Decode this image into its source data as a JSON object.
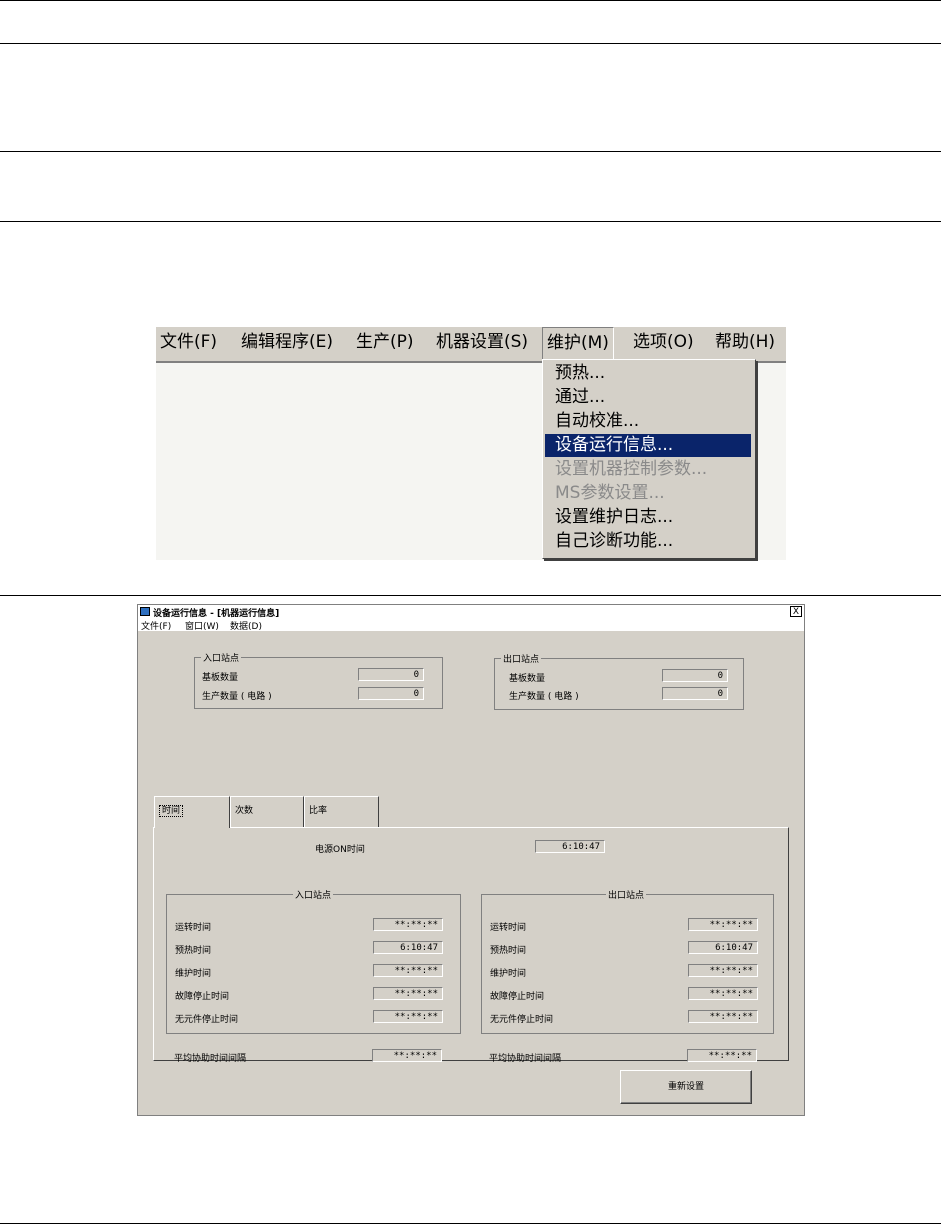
{
  "menu_screenshot": {
    "menubar": [
      {
        "label": "文件(F)"
      },
      {
        "label": "编辑程序(E)"
      },
      {
        "label": "生产(P)"
      },
      {
        "label": "机器设置(S)"
      },
      {
        "label": "维护(M)"
      },
      {
        "label": "选项(O)"
      },
      {
        "label": "帮助(H)"
      }
    ],
    "maintenance_dropdown": [
      {
        "label": "预热..."
      },
      {
        "label": "通过..."
      },
      {
        "label": "自动校准..."
      },
      {
        "label": "设备运行信息...",
        "state": "selected"
      },
      {
        "label": "设置机器控制参数...",
        "state": "disabled"
      },
      {
        "label": "MS参数设置...",
        "state": "disabled"
      },
      {
        "label": "设置维护日志..."
      },
      {
        "label": "自己诊断功能..."
      }
    ],
    "selection_color": "#0a246a"
  },
  "window": {
    "title": "设备运行信息 - [机器运行信息]",
    "close_label": "X",
    "menubar": [
      "文件(F)",
      "窗口(W)",
      "数据(D)"
    ],
    "entrance_station": {
      "legend": "入口站点",
      "board_count_label": "基板数量",
      "board_count_value": "0",
      "production_count_label": "生产数量 ( 电路 )",
      "production_count_value": "0"
    },
    "exit_station": {
      "legend": "出口站点",
      "board_count_label": "基板数量",
      "board_count_value": "0",
      "production_count_label": "生产数量 ( 电路 )",
      "production_count_value": "0"
    },
    "tabs": [
      {
        "label": "时间",
        "active": true
      },
      {
        "label": "次数"
      },
      {
        "label": "比率"
      }
    ],
    "power_on_label": "电源ON时间",
    "power_on_value": "6:10:47",
    "time_entrance": {
      "legend": "入口站点",
      "rows": [
        {
          "label": "运转时间",
          "value": "**:**:**"
        },
        {
          "label": "预热时间",
          "value": "6:10:47"
        },
        {
          "label": "维护时间",
          "value": "**:**:**"
        },
        {
          "label": "故障停止时间",
          "value": "**:**:**"
        },
        {
          "label": "无元件停止时间",
          "value": "**:**:**"
        },
        {
          "label": "平均协助时间间隔",
          "value": "**:**:**"
        }
      ]
    },
    "time_exit": {
      "legend": "出口站点",
      "rows": [
        {
          "label": "运转时间",
          "value": "**:**:**"
        },
        {
          "label": "预热时间",
          "value": "6:10:47"
        },
        {
          "label": "维护时间",
          "value": "**:**:**"
        },
        {
          "label": "故障停止时间",
          "value": "**:**:**"
        },
        {
          "label": "无元件停止时间",
          "value": "**:**:**"
        },
        {
          "label": "平均协助时间间隔",
          "value": "**:**:**"
        }
      ]
    },
    "reset_button": "重新设置"
  }
}
